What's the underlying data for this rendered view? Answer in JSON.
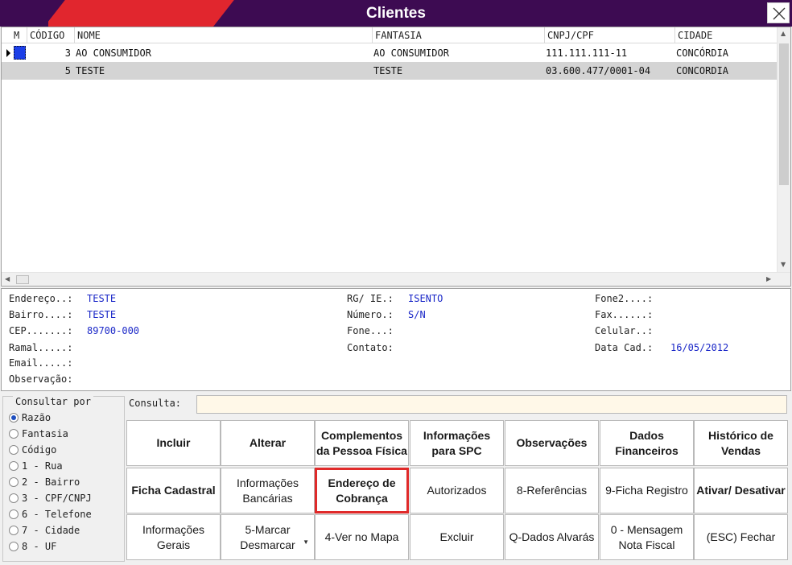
{
  "window": {
    "title": "Clientes"
  },
  "grid": {
    "columns": [
      "M",
      "CÓDIGO",
      "NOME",
      "FANTASIA",
      "CNPJ/CPF",
      "CIDADE"
    ],
    "rows": [
      {
        "codigo": "3",
        "nome": "AO CONSUMIDOR",
        "fantasia": "AO CONSUMIDOR",
        "cnpj": "111.111.111-11",
        "cidade": "CONCÓRDIA"
      },
      {
        "codigo": "5",
        "nome": "TESTE",
        "fantasia": "TESTE",
        "cnpj": "03.600.477/0001-04",
        "cidade": "CONCORDIA"
      }
    ]
  },
  "details": {
    "endereco_label": "Endereço..:",
    "endereco": "TESTE",
    "bairro_label": "Bairro....:",
    "bairro": "TESTE",
    "cep_label": "CEP.......:",
    "cep": "89700-000",
    "ramal_label": "Ramal.....:",
    "email_label": "Email.....:",
    "obs_label": "Observação:",
    "rg_label": "RG/ IE.:",
    "rg": "ISENTO",
    "numero_label": "Número.:",
    "numero": "S/N",
    "fone_label": "Fone...:",
    "contato_label": "Contato:",
    "fone2_label": "Fone2....:",
    "fax_label": "Fax......:",
    "celular_label": "Celular..:",
    "datacad_label": "Data Cad.:",
    "datacad": "16/05/2012"
  },
  "consultar": {
    "legend": "Consultar por",
    "options": [
      "Razão",
      "Fantasia",
      "Código",
      "1 - Rua",
      "2 - Bairro",
      "3 - CPF/CNPJ",
      "6 - Telefone",
      "7 - Cidade",
      "8 - UF"
    ],
    "selected": "Razão"
  },
  "consulta": {
    "label": "Consulta:",
    "value": ""
  },
  "buttons": {
    "incluir": "Incluir",
    "alterar": "Alterar",
    "complementos": "Complementos da Pessoa Física",
    "info_spc": "Informações para SPC",
    "observacoes": "Observações",
    "dados_fin": "Dados Financeiros",
    "hist_vendas": "Histórico de Vendas",
    "ficha_cad": "Ficha Cadastral",
    "info_banc": "Informações Bancárias",
    "end_cobranca": "Endereço de Cobrança",
    "autorizados": "Autorizados",
    "referencias": "8-Referências",
    "ficha_reg": "9-Ficha Registro",
    "ativar": "Ativar/ Desativar",
    "info_gerais": "Informações Gerais",
    "marcar": "5-Marcar Desmarcar",
    "ver_mapa": "4-Ver no Mapa",
    "excluir": "Excluir",
    "dados_alvaras": "Q-Dados Alvarás",
    "mensagem_nf": "0 - Mensagem Nota Fiscal",
    "fechar": "(ESC) Fechar"
  },
  "colors": {
    "title_bg": "#3d0b52",
    "title_accent": "#e1262e",
    "value_text": "#1b28c8",
    "highlight_border": "#e02a2a"
  }
}
